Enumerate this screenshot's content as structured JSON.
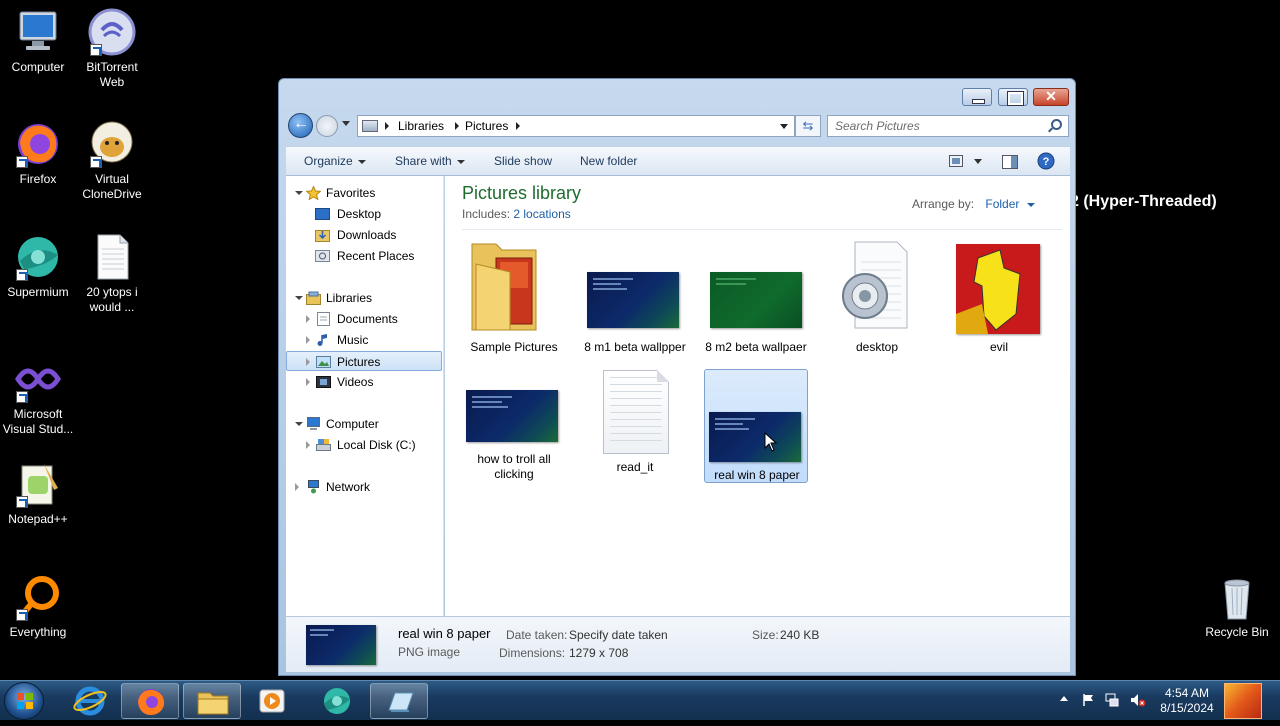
{
  "desktop": {
    "icons": [
      {
        "label": "Computer",
        "icon": "computer-icon"
      },
      {
        "label": "BitTorrent Web",
        "icon": "bittorrent-icon"
      },
      {
        "label": "Firefox",
        "icon": "firefox-icon"
      },
      {
        "label": "Virtual CloneDrive",
        "icon": "sheep-icon"
      },
      {
        "label": "Supermium",
        "icon": "supermium-icon"
      },
      {
        "label": "20 ytops i would ...",
        "icon": "text-file-icon"
      },
      {
        "label": "Microsoft Visual Stud...",
        "icon": "visual-studio-icon"
      },
      {
        "label": "Notepad++",
        "icon": "notepadpp-icon"
      },
      {
        "label": "Everything",
        "icon": "everything-icon"
      },
      {
        "label": "Recycle Bin",
        "icon": "recycle-bin-icon"
      }
    ],
    "overlay_text": "2 (Hyper-Threaded)"
  },
  "window": {
    "close_glyph": "✕",
    "address": {
      "segments": [
        "Libraries",
        "Pictures"
      ]
    },
    "search": {
      "placeholder": "Search Pictures"
    },
    "commands": [
      "Organize",
      "Share with",
      "Slide show",
      "New folder"
    ],
    "nav": {
      "favorites": "Favorites",
      "desktop": "Desktop",
      "downloads": "Downloads",
      "recent": "Recent Places",
      "libraries": "Libraries",
      "documents": "Documents",
      "music": "Music",
      "pictures": "Pictures",
      "videos": "Videos",
      "computer": "Computer",
      "local_disk": "Local Disk (C:)",
      "network": "Network"
    },
    "library": {
      "title": "Pictures library",
      "includes_label": "Includes:",
      "includes_link": "2 locations",
      "arrange_label": "Arrange by:",
      "arrange_value": "Folder"
    },
    "items": [
      {
        "name": "Sample Pictures"
      },
      {
        "name": "8 m1 beta wallpper"
      },
      {
        "name": "8 m2 beta wallpaer"
      },
      {
        "name": "desktop"
      },
      {
        "name": "evil"
      },
      {
        "name": "how to troll all clicking"
      },
      {
        "name": "read_it"
      },
      {
        "name": "real win 8 paper"
      }
    ],
    "details": {
      "name": "real win 8 paper",
      "type": "PNG image",
      "date_label": "Date taken:",
      "date_value": "Specify date taken",
      "dim_label": "Dimensions:",
      "dim_value": "1279 x 708",
      "size_label": "Size:",
      "size_value": "240 KB"
    }
  },
  "taskbar": {
    "time": "4:54 AM",
    "date": "8/15/2024"
  }
}
